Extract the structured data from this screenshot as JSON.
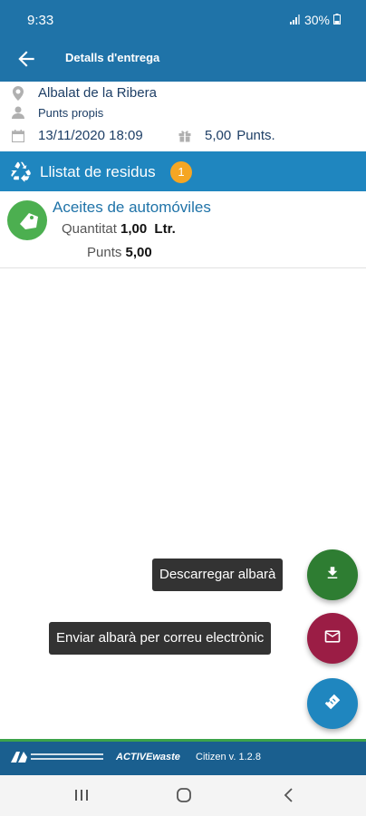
{
  "status": {
    "time": "9:33",
    "battery": "30%"
  },
  "appbar": {
    "title": "Detalls d'entrega"
  },
  "info": {
    "location": "Albalat de la Ribera",
    "owner": "Punts propis",
    "datetime": "13/11/2020 18:09",
    "points": "5,00",
    "points_unit": "Punts."
  },
  "list": {
    "title": "Llistat de residus",
    "count": "1"
  },
  "items": [
    {
      "name": "Aceites de automóviles",
      "qty_label": "Quantitat",
      "qty": "1,00",
      "qty_unit": "Ltr.",
      "pts_label": "Punts",
      "pts": "5,00"
    }
  ],
  "actions": {
    "download_label": "Descarregar albarà",
    "email_label": "Enviar albarà per correu electrònic"
  },
  "colors": {
    "primary": "#1f73a8",
    "listbar": "#1f86bf",
    "download": "#2e7d32",
    "email": "#9b1d45",
    "main_fab": "#1f86bf",
    "badge": "#f5a623"
  },
  "footer": {
    "brand": "ACTIVEwaste",
    "version": "Citizen v. 1.2.8"
  }
}
